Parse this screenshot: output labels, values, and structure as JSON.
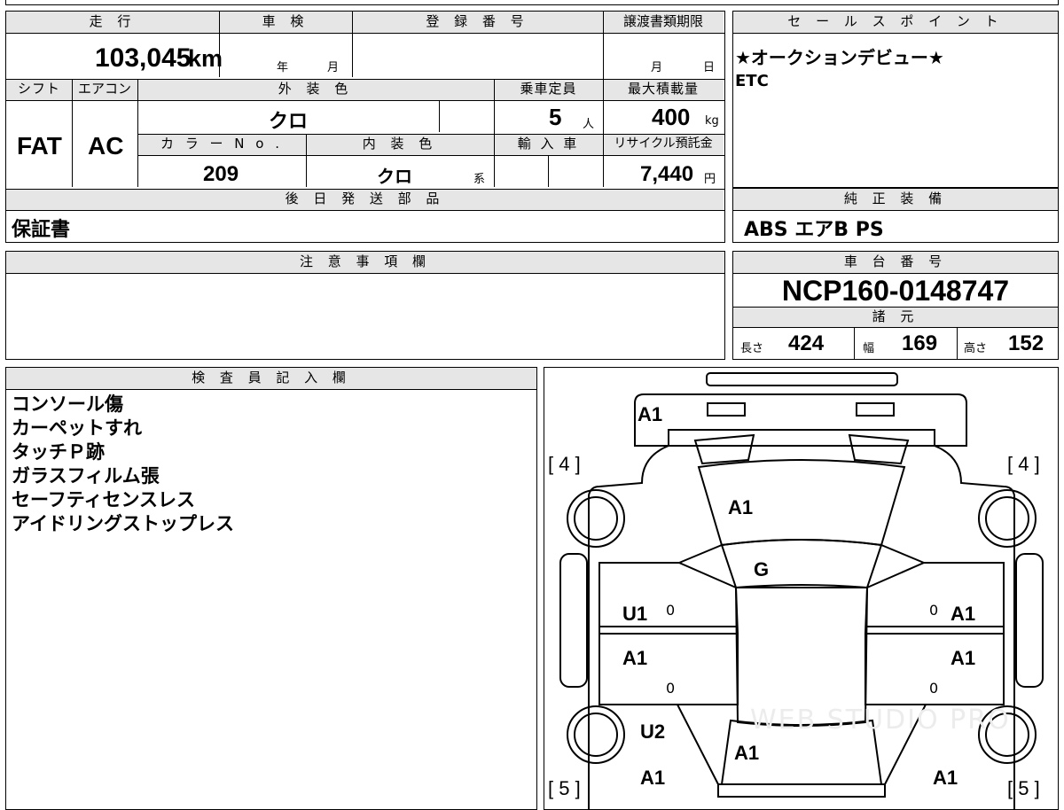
{
  "top_box": {
    "headers": {
      "mileage": "走 行",
      "inspection": "車 検",
      "registration": "登 録 番 号",
      "transfer_deadline": "譲渡書類期限",
      "shift": "シフト",
      "aircon": "エアコン",
      "exterior_color": "外 装 色",
      "capacity": "乗車定員",
      "max_load": "最大積載量",
      "color_no": "カ ラ ー N o .",
      "interior_color": "内 装 色",
      "import": "輸 入 車",
      "recycle": "リサイクル預託金",
      "later_parts": "後 日 発 送 部 品"
    },
    "mileage_value": "103,045",
    "mileage_unit": "km",
    "inspection_year": "年",
    "inspection_month": "月",
    "transfer_month": "月",
    "transfer_day": "日",
    "shift_value": "FAT",
    "aircon_value": "AC",
    "exterior_color_value": "クロ",
    "capacity_value": "5",
    "capacity_unit": "人",
    "max_load_value": "400",
    "max_load_unit": "kg",
    "color_no_value": "209",
    "interior_color_value": "クロ",
    "interior_suffix": "系",
    "recycle_value": "7,440",
    "recycle_unit": "円",
    "later_parts_value": "保証書"
  },
  "sales_point": {
    "header": "セ ー ル ス ポ イ ン ト",
    "line1": "★オークションデビュー★",
    "line2": "ETC"
  },
  "equipment": {
    "header": "純 正 装 備",
    "value": "ABS エアB PS"
  },
  "notes": {
    "header": "注 意 事 項 欄"
  },
  "chassis": {
    "header": "車 台 番 号",
    "value": "NCP160-0148747",
    "specs_header": "諸 元",
    "length_label": "長さ",
    "length_value": "424",
    "width_label": "幅",
    "width_value": "169",
    "height_label": "高さ",
    "height_value": "152"
  },
  "inspector": {
    "header": "検 査 員 記 入 欄",
    "items": [
      "コンソール傷",
      "カーペットすれ",
      "タッチＰ跡",
      "ガラスフィルム張",
      "セーフティセンスレス",
      "アイドリングストップレス"
    ]
  },
  "diagram": {
    "front_bumper": "A1",
    "hood": "A1",
    "windshield": "G",
    "front_left_door": "U1",
    "front_right_door": "A1",
    "rear_left_door": "A1",
    "rear_right_door": "A1",
    "left_rear_fender": "U2",
    "roof_rear": "A1",
    "rear_left_corner": "A1",
    "rear_right_corner": "A1",
    "tire_fl": "[ 4 ]",
    "tire_fr": "[ 4 ]",
    "tire_rl": "[ 5 ]",
    "tire_rr": "[ 5 ]",
    "zero": "0",
    "watermark": "WEB STUDIO PRO"
  }
}
